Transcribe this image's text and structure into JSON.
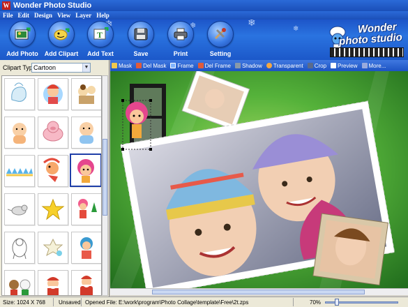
{
  "window": {
    "title": "Wonder Photo Studio"
  },
  "menu": [
    "File",
    "Edit",
    "Design",
    "View",
    "Layer",
    "Help"
  ],
  "toolbar": {
    "buttons": [
      {
        "label": "Add Photo",
        "icon": "add-photo-icon"
      },
      {
        "label": "Add Clipart",
        "icon": "add-clipart-icon"
      },
      {
        "label": "Add Text",
        "icon": "add-text-icon"
      },
      {
        "label": "Save",
        "icon": "save-icon"
      },
      {
        "label": "Print",
        "icon": "print-icon"
      },
      {
        "label": "Setting",
        "icon": "setting-icon"
      }
    ],
    "logo_line1": "Wonder",
    "logo_line2": "photo studio"
  },
  "clipart": {
    "type_label": "Clipart Type",
    "type_value": "Cartoon",
    "selected_index": 8
  },
  "edit_toolbar": [
    {
      "label": "Mask",
      "icon": "mask-icon",
      "color": "#f2c94c"
    },
    {
      "label": "Del Mask",
      "icon": "delete-mask-icon",
      "color": "#e05b3a"
    },
    {
      "label": "Frame",
      "icon": "frame-icon",
      "color": "#7fb3ff"
    },
    {
      "label": "Del Frame",
      "icon": "delete-frame-icon",
      "color": "#e05b3a"
    },
    {
      "label": "Shadow",
      "icon": "shadow-icon",
      "color": "#8899aa"
    },
    {
      "label": "Transparent",
      "icon": "transparent-icon",
      "color": "#f5a742"
    },
    {
      "label": "Crop",
      "icon": "crop-icon",
      "color": "#5a6b8c"
    },
    {
      "label": "Preview",
      "icon": "preview-icon",
      "color": "#ffffff"
    },
    {
      "label": "More...",
      "icon": "more-icon",
      "color": "#9ad"
    }
  ],
  "status": {
    "size": "Size: 1024 X 768",
    "saved": "Unsaved",
    "opened_file": "Opened File:  E:\\work\\program\\Photo Collage\\template\\Free\\2t.zps",
    "zoom": "70%"
  },
  "colors": {
    "accent": "#1d55c8",
    "canvas_green": "#3e9a2c",
    "title_bar": "#2b6ad8"
  }
}
